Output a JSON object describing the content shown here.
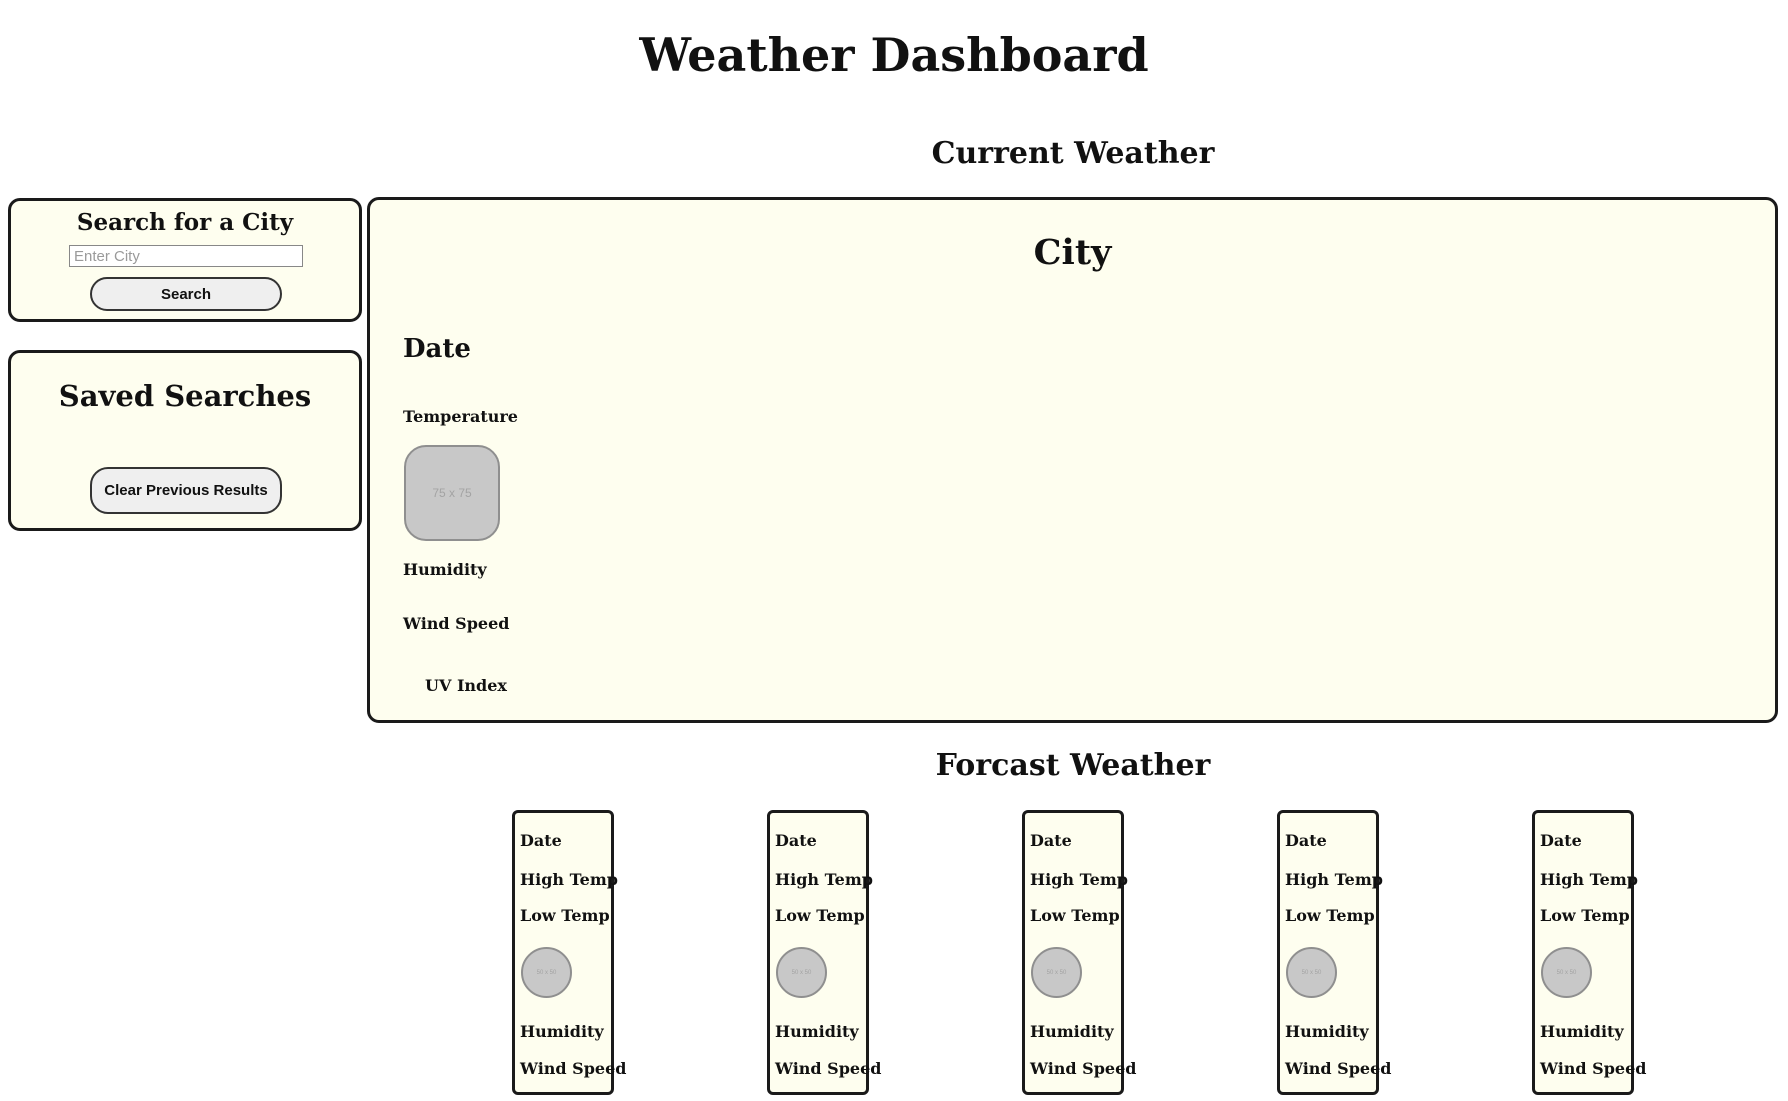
{
  "header": {
    "title": "Weather Dashboard"
  },
  "search": {
    "heading": "Search for a City",
    "placeholder": "Enter City",
    "value": "",
    "button_label": "Search"
  },
  "saved": {
    "heading": "Saved Searches",
    "clear_label": "Clear Previous Results"
  },
  "current": {
    "section_title": "Current Weather",
    "city": "City",
    "date": "Date",
    "temperature": "Temperature",
    "icon_placeholder": "75 x 75",
    "humidity": "Humidity",
    "wind_speed": "Wind Speed",
    "uv_index": "UV Index"
  },
  "forecast": {
    "section_title": "Forcast Weather",
    "cards": [
      {
        "date": "Date",
        "high": "High Temp",
        "low": "Low Temp",
        "icon_placeholder": "50 x 50",
        "humidity": "Humidity",
        "wind": "Wind Speed"
      },
      {
        "date": "Date",
        "high": "High Temp",
        "low": "Low Temp",
        "icon_placeholder": "50 x 50",
        "humidity": "Humidity",
        "wind": "Wind Speed"
      },
      {
        "date": "Date",
        "high": "High Temp",
        "low": "Low Temp",
        "icon_placeholder": "50 x 50",
        "humidity": "Humidity",
        "wind": "Wind Speed"
      },
      {
        "date": "Date",
        "high": "High Temp",
        "low": "Low Temp",
        "icon_placeholder": "50 x 50",
        "humidity": "Humidity",
        "wind": "Wind Speed"
      },
      {
        "date": "Date",
        "high": "High Temp",
        "low": "Low Temp",
        "icon_placeholder": "50 x 50",
        "humidity": "Humidity",
        "wind": "Wind Speed"
      }
    ]
  },
  "colors": {
    "panel_background": "#fefeef",
    "panel_border": "#1a1a1a",
    "icon_placeholder": "#c8c8c8",
    "button_background": "#efefef"
  }
}
